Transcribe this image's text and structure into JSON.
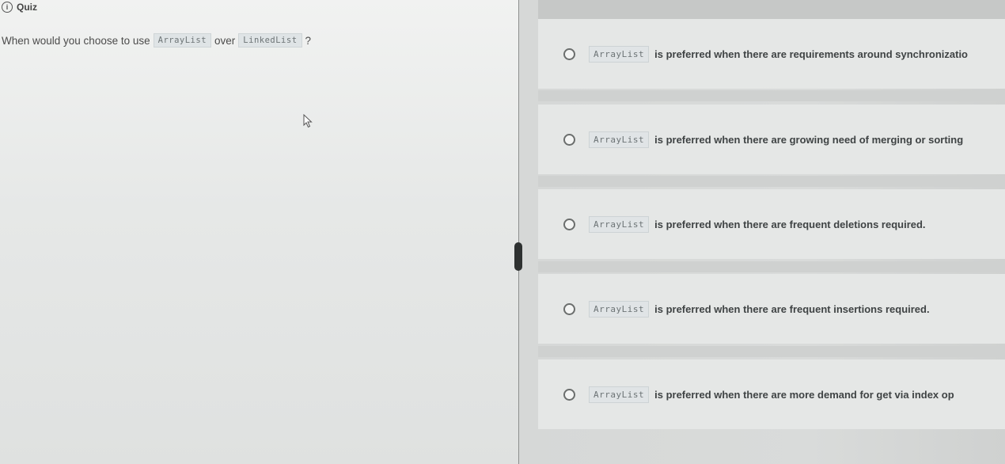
{
  "quiz": {
    "icon": "info-circle-icon",
    "title": "Quiz"
  },
  "question": {
    "prefix": "When would you choose to use",
    "code1": "ArrayList",
    "middle": "over",
    "code2": "LinkedList",
    "suffix": "?"
  },
  "options": [
    {
      "code": "ArrayList",
      "text": "is preferred when there are requirements around synchronizatio"
    },
    {
      "code": "ArrayList",
      "text": "is preferred when there are growing need of merging or sorting"
    },
    {
      "code": "ArrayList",
      "text": "is preferred when there are frequent deletions required."
    },
    {
      "code": "ArrayList",
      "text": "is preferred when there are frequent insertions required."
    },
    {
      "code": "ArrayList",
      "text": "is preferred when there are more demand for get via index op"
    }
  ],
  "colors": {
    "left_background": "#eceeed",
    "right_background": "#d8dad9",
    "option_background": "#e5e7e6",
    "splitter": "#2e3131"
  }
}
